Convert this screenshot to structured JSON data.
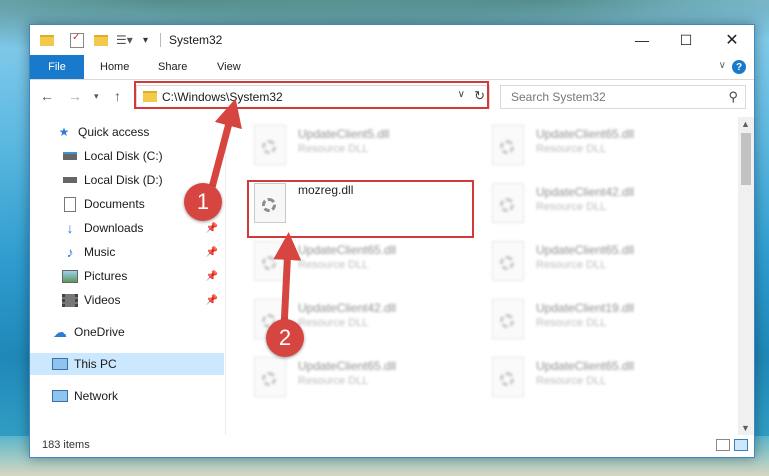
{
  "window": {
    "title": "System32"
  },
  "ribbon": {
    "tabs": [
      "File",
      "Home",
      "Share",
      "View"
    ],
    "help": "?"
  },
  "address": {
    "path": "C:\\Windows\\System32",
    "search_placeholder": "Search System32"
  },
  "sidebar": {
    "items": [
      {
        "label": "Quick access",
        "icon": "star-icon",
        "pinned": false
      },
      {
        "label": "Local Disk (C:)",
        "icon": "drive-icon",
        "pinned": false
      },
      {
        "label": "Local Disk (D:)",
        "icon": "drive-icon",
        "pinned": false
      },
      {
        "label": "Documents",
        "icon": "documents-icon",
        "pinned": true
      },
      {
        "label": "Downloads",
        "icon": "download-icon",
        "pinned": true
      },
      {
        "label": "Music",
        "icon": "music-icon",
        "pinned": true
      },
      {
        "label": "Pictures",
        "icon": "pictures-icon",
        "pinned": true
      },
      {
        "label": "Videos",
        "icon": "videos-icon",
        "pinned": true
      },
      {
        "label": "OneDrive",
        "icon": "cloud-icon",
        "pinned": false
      },
      {
        "label": "This PC",
        "icon": "computer-icon",
        "pinned": false,
        "selected": true
      },
      {
        "label": "Network",
        "icon": "network-icon",
        "pinned": false
      }
    ]
  },
  "files": [
    {
      "name": "UpdateClient5.dll",
      "type": "Resource DLL",
      "blurred": true
    },
    {
      "name": "UpdateClient65.dll",
      "type": "Resource DLL",
      "blurred": true
    },
    {
      "name": "mozreg.dll",
      "type": "",
      "blurred": false
    },
    {
      "name": "UpdateClient42.dll",
      "type": "Resource DLL",
      "blurred": true
    },
    {
      "name": "UpdateClient65.dll",
      "type": "Resource DLL",
      "blurred": true
    },
    {
      "name": "UpdateClient65.dll",
      "type": "Resource DLL",
      "blurred": true
    },
    {
      "name": "UpdateClient42.dll",
      "type": "Resource DLL",
      "blurred": true
    },
    {
      "name": "UpdateClient19.dll",
      "type": "Resource DLL",
      "blurred": true
    },
    {
      "name": "UpdateClient65.dll",
      "type": "Resource DLL",
      "blurred": true
    },
    {
      "name": "UpdateClient65.dll",
      "type": "Resource DLL",
      "blurred": true
    }
  ],
  "status": {
    "item_count": "183 items"
  },
  "annotations": {
    "step1": "1",
    "step2": "2",
    "color": "#d23a3a"
  }
}
